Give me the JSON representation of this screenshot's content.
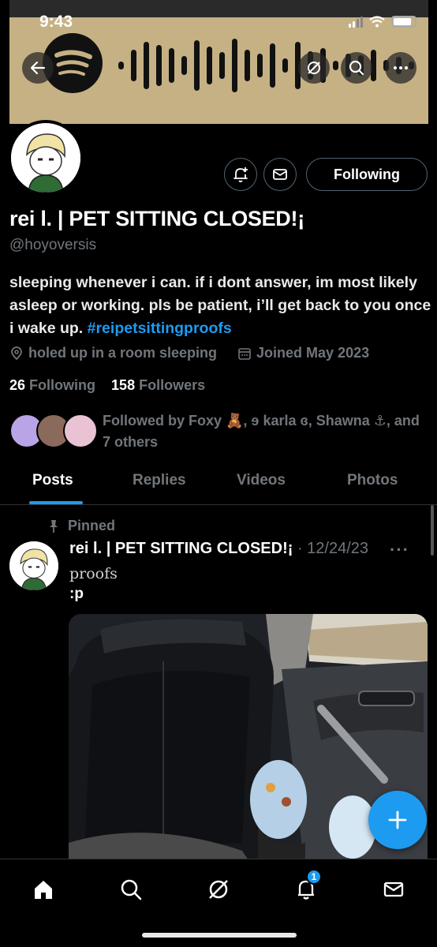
{
  "status": {
    "time": "9:43"
  },
  "profile": {
    "name": "rei l. | PET SITTING CLOSED!¡",
    "handle": "@hoyoversis",
    "bio_text": "sleeping whenever i can. if i dont answer, im most likely asleep or working. pls be patient, i’ll get back to you once i wake up.",
    "bio_hashtag": "#reipetsittingproofs",
    "location": "holed up in a room sleeping",
    "joined": "Joined May 2023",
    "following_count": "26",
    "following_label": "Following",
    "followers_count": "158",
    "followers_label": "Followers",
    "followed_by": "Followed by Foxy 🧸, ɘ karla ɞ, Shawna ⚓, and 7 others",
    "following_button": "Following"
  },
  "tabs": [
    {
      "label": "Posts",
      "active": true
    },
    {
      "label": "Replies",
      "active": false
    },
    {
      "label": "Videos",
      "active": false
    },
    {
      "label": "Photos",
      "active": false
    }
  ],
  "post": {
    "pinned_label": "Pinned",
    "author": "rei l. | PET SITTING CLOSED!¡",
    "date": "· 12/24/23",
    "more": "···",
    "line1": "proofs",
    "line2": ":p"
  },
  "nav": {
    "notification_badge": "1"
  },
  "colors": {
    "accent": "#1d9bf0",
    "background": "#000000",
    "muted": "#71767b",
    "banner": "#c6b184"
  },
  "icons": [
    "back-arrow-icon",
    "spotify-logo-icon",
    "grok-icon",
    "search-icon",
    "more-icon",
    "notification-add-icon",
    "mail-icon",
    "location-icon",
    "calendar-icon",
    "pin-icon",
    "plus-icon",
    "home-icon",
    "bell-icon"
  ]
}
